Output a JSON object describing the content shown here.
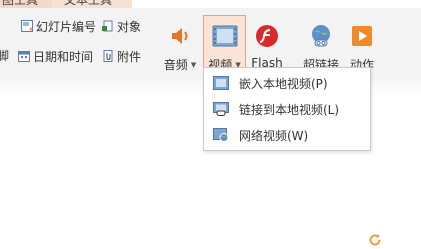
{
  "tabs": [
    "图工具",
    "文本工具"
  ],
  "ribbon": {
    "small_items": [
      {
        "label": "幻灯片编号",
        "icon": "slide-number-icon"
      },
      {
        "label": "对象",
        "icon": "object-icon"
      },
      {
        "label": "日期和时间",
        "icon": "date-time-icon"
      },
      {
        "label": "附件",
        "icon": "attachment-icon"
      }
    ],
    "big_buttons": {
      "audio": {
        "label": "音频",
        "icon": "audio-icon"
      },
      "video": {
        "label": "视频",
        "icon": "video-icon"
      },
      "flash": {
        "label": "Flash",
        "icon": "flash-icon"
      },
      "hyperlink": {
        "label": "超链接",
        "icon": "hyperlink-icon"
      },
      "action": {
        "label": "动作",
        "icon": "action-icon"
      }
    },
    "left_cut": "脚"
  },
  "video_menu": {
    "items": [
      {
        "label": "嵌入本地视频(P)",
        "icon": "embed-video-icon"
      },
      {
        "label": "链接到本地视频(L)",
        "icon": "link-video-icon"
      },
      {
        "label": "网络视频(W)",
        "icon": "web-video-icon"
      }
    ]
  },
  "colors": {
    "ribbon_bg": "#f3f3f3",
    "active_button_bg": "#fbe3d6",
    "active_button_border": "#e3a08a",
    "accent_orange": "#e8742a"
  }
}
